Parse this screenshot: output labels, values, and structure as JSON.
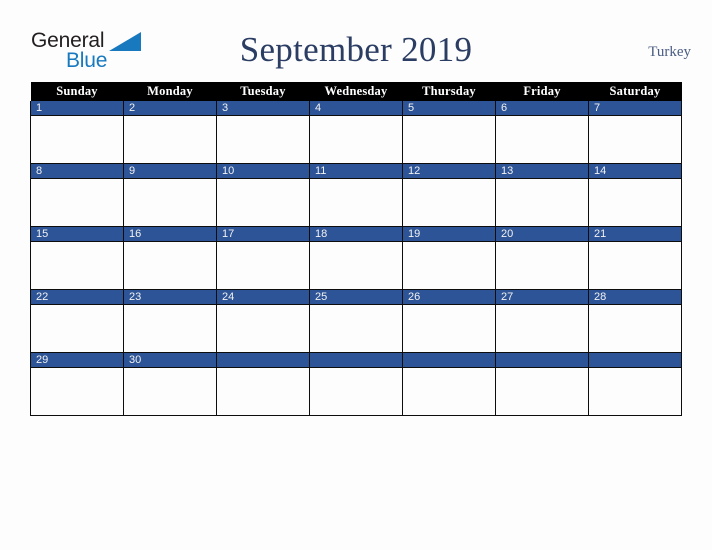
{
  "brand": {
    "name_part1": "General",
    "name_part2": "Blue",
    "color_dark": "#231f20",
    "color_blue": "#1879bf"
  },
  "header": {
    "title": "September 2019",
    "country": "Turkey",
    "title_color": "#2b3d63",
    "country_color": "#4a5d82"
  },
  "calendar": {
    "accent_color": "#2d5496",
    "header_bg": "#000000",
    "weekday_headers": [
      "Sunday",
      "Monday",
      "Tuesday",
      "Wednesday",
      "Thursday",
      "Friday",
      "Saturday"
    ],
    "weeks": [
      {
        "days": [
          "1",
          "2",
          "3",
          "4",
          "5",
          "6",
          "7"
        ]
      },
      {
        "days": [
          "8",
          "9",
          "10",
          "11",
          "12",
          "13",
          "14"
        ]
      },
      {
        "days": [
          "15",
          "16",
          "17",
          "18",
          "19",
          "20",
          "21"
        ]
      },
      {
        "days": [
          "22",
          "23",
          "24",
          "25",
          "26",
          "27",
          "28"
        ]
      },
      {
        "days": [
          "29",
          "30",
          "",
          "",
          "",
          "",
          ""
        ]
      }
    ]
  }
}
